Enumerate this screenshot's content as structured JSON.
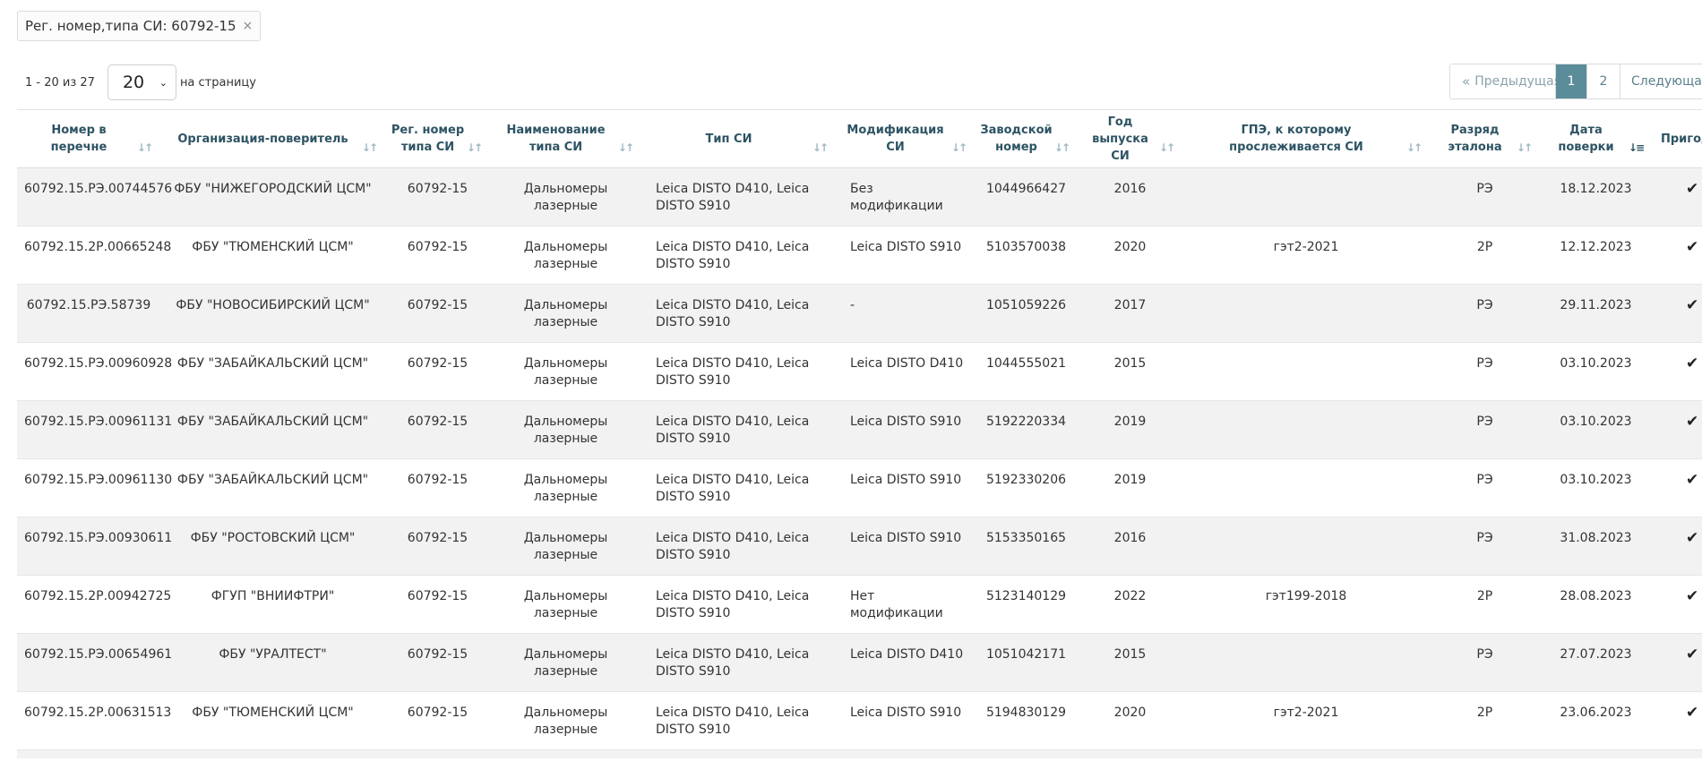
{
  "filter": {
    "label": "Рег. номер,типа СИ: 60792-15",
    "remove_glyph": "×"
  },
  "pager": {
    "range_text": "1 - 20 из 27",
    "per_page_value": "20",
    "per_page_label": "на страницу",
    "prev_label": "Предыдущая",
    "pages": [
      "1",
      "2"
    ],
    "current_page": "1",
    "next_label": "Следующая"
  },
  "icons": {
    "prev": "double-chevron-left-icon",
    "sort": "sort-arrows-icon",
    "sort_active": "sort-descending-icon",
    "check": "checkmark-icon",
    "select": "chevron-down-icon"
  },
  "colors": {
    "accent": "#5b8c99",
    "header_text": "#2d5363",
    "stripe": "#f2f2f2"
  },
  "columns": [
    {
      "key": "num",
      "label": "Номер в перечне"
    },
    {
      "key": "org",
      "label": "Организация-поверитель"
    },
    {
      "key": "reg",
      "label": "Рег. номер типа СИ"
    },
    {
      "key": "name",
      "label": "Наименование типа СИ"
    },
    {
      "key": "type",
      "label": "Тип СИ"
    },
    {
      "key": "mod",
      "label": "Модификация СИ"
    },
    {
      "key": "serial",
      "label": "Заводской номер"
    },
    {
      "key": "year",
      "label": "Год выпуска СИ"
    },
    {
      "key": "gpe",
      "label": "ГПЭ, к которому прослеживается СИ"
    },
    {
      "key": "rank",
      "label": "Разряд эталона"
    },
    {
      "key": "date",
      "label": "Дата поверки"
    },
    {
      "key": "valid",
      "label": "Пригодность"
    }
  ],
  "rows": [
    {
      "num": "60792.15.РЭ.00744576",
      "org": "ФБУ \"НИЖЕГОРОДСКИЙ ЦСМ\"",
      "reg": "60792-15",
      "name": "Дальномеры лазерные",
      "type": "Leica DISTO D410, Leica DISTO S910",
      "mod": "Без модификации",
      "serial": "1044966427",
      "year": "2016",
      "gpe": "",
      "rank": "РЭ",
      "date": "18.12.2023",
      "valid": "✔"
    },
    {
      "num": "60792.15.2Р.00665248",
      "org": "ФБУ \"ТЮМЕНСКИЙ ЦСМ\"",
      "reg": "60792-15",
      "name": "Дальномеры лазерные",
      "type": "Leica DISTO D410, Leica DISTO S910",
      "mod": "Leica DISTO S910",
      "serial": "5103570038",
      "year": "2020",
      "gpe": "гэт2-2021",
      "rank": "2Р",
      "date": "12.12.2023",
      "valid": "✔"
    },
    {
      "num": "60792.15.РЭ.58739",
      "org": "ФБУ \"НОВОСИБИРСКИЙ ЦСМ\"",
      "reg": "60792-15",
      "name": "Дальномеры лазерные",
      "type": "Leica DISTO D410, Leica DISTO S910",
      "mod": "-",
      "serial": "1051059226",
      "year": "2017",
      "gpe": "",
      "rank": "РЭ",
      "date": "29.11.2023",
      "valid": "✔"
    },
    {
      "num": "60792.15.РЭ.00960928",
      "org": "ФБУ \"ЗАБАЙКАЛЬСКИЙ ЦСМ\"",
      "reg": "60792-15",
      "name": "Дальномеры лазерные",
      "type": "Leica DISTO D410, Leica DISTO S910",
      "mod": "Leica DISTO D410",
      "serial": "1044555021",
      "year": "2015",
      "gpe": "",
      "rank": "РЭ",
      "date": "03.10.2023",
      "valid": "✔"
    },
    {
      "num": "60792.15.РЭ.00961131",
      "org": "ФБУ \"ЗАБАЙКАЛЬСКИЙ ЦСМ\"",
      "reg": "60792-15",
      "name": "Дальномеры лазерные",
      "type": "Leica DISTO D410, Leica DISTO S910",
      "mod": "Leica DISTO S910",
      "serial": "5192220334",
      "year": "2019",
      "gpe": "",
      "rank": "РЭ",
      "date": "03.10.2023",
      "valid": "✔"
    },
    {
      "num": "60792.15.РЭ.00961130",
      "org": "ФБУ \"ЗАБАЙКАЛЬСКИЙ ЦСМ\"",
      "reg": "60792-15",
      "name": "Дальномеры лазерные",
      "type": "Leica DISTO D410, Leica DISTO S910",
      "mod": "Leica DISTO S910",
      "serial": "5192330206",
      "year": "2019",
      "gpe": "",
      "rank": "РЭ",
      "date": "03.10.2023",
      "valid": "✔"
    },
    {
      "num": "60792.15.РЭ.00930611",
      "org": "ФБУ \"РОСТОВСКИЙ ЦСМ\"",
      "reg": "60792-15",
      "name": "Дальномеры лазерные",
      "type": "Leica DISTO D410, Leica DISTO S910",
      "mod": "Leica DISTO S910",
      "serial": "5153350165",
      "year": "2016",
      "gpe": "",
      "rank": "РЭ",
      "date": "31.08.2023",
      "valid": "✔"
    },
    {
      "num": "60792.15.2Р.00942725",
      "org": "ФГУП \"ВНИИФТРИ\"",
      "reg": "60792-15",
      "name": "Дальномеры лазерные",
      "type": "Leica DISTO D410, Leica DISTO S910",
      "mod": "Нет модификации",
      "serial": "5123140129",
      "year": "2022",
      "gpe": "гэт199-2018",
      "rank": "2Р",
      "date": "28.08.2023",
      "valid": "✔"
    },
    {
      "num": "60792.15.РЭ.00654961",
      "org": "ФБУ \"УРАЛТЕСТ\"",
      "reg": "60792-15",
      "name": "Дальномеры лазерные",
      "type": "Leica DISTO D410, Leica DISTO S910",
      "mod": "Leica DISTO D410",
      "serial": "1051042171",
      "year": "2015",
      "gpe": "",
      "rank": "РЭ",
      "date": "27.07.2023",
      "valid": "✔"
    },
    {
      "num": "60792.15.2Р.00631513",
      "org": "ФБУ \"ТЮМЕНСКИЙ ЦСМ\"",
      "reg": "60792-15",
      "name": "Дальномеры лазерные",
      "type": "Leica DISTO D410, Leica DISTO S910",
      "mod": "Leica DISTO S910",
      "serial": "5194830129",
      "year": "2020",
      "gpe": "гэт2-2021",
      "rank": "2Р",
      "date": "23.06.2023",
      "valid": "✔"
    }
  ]
}
